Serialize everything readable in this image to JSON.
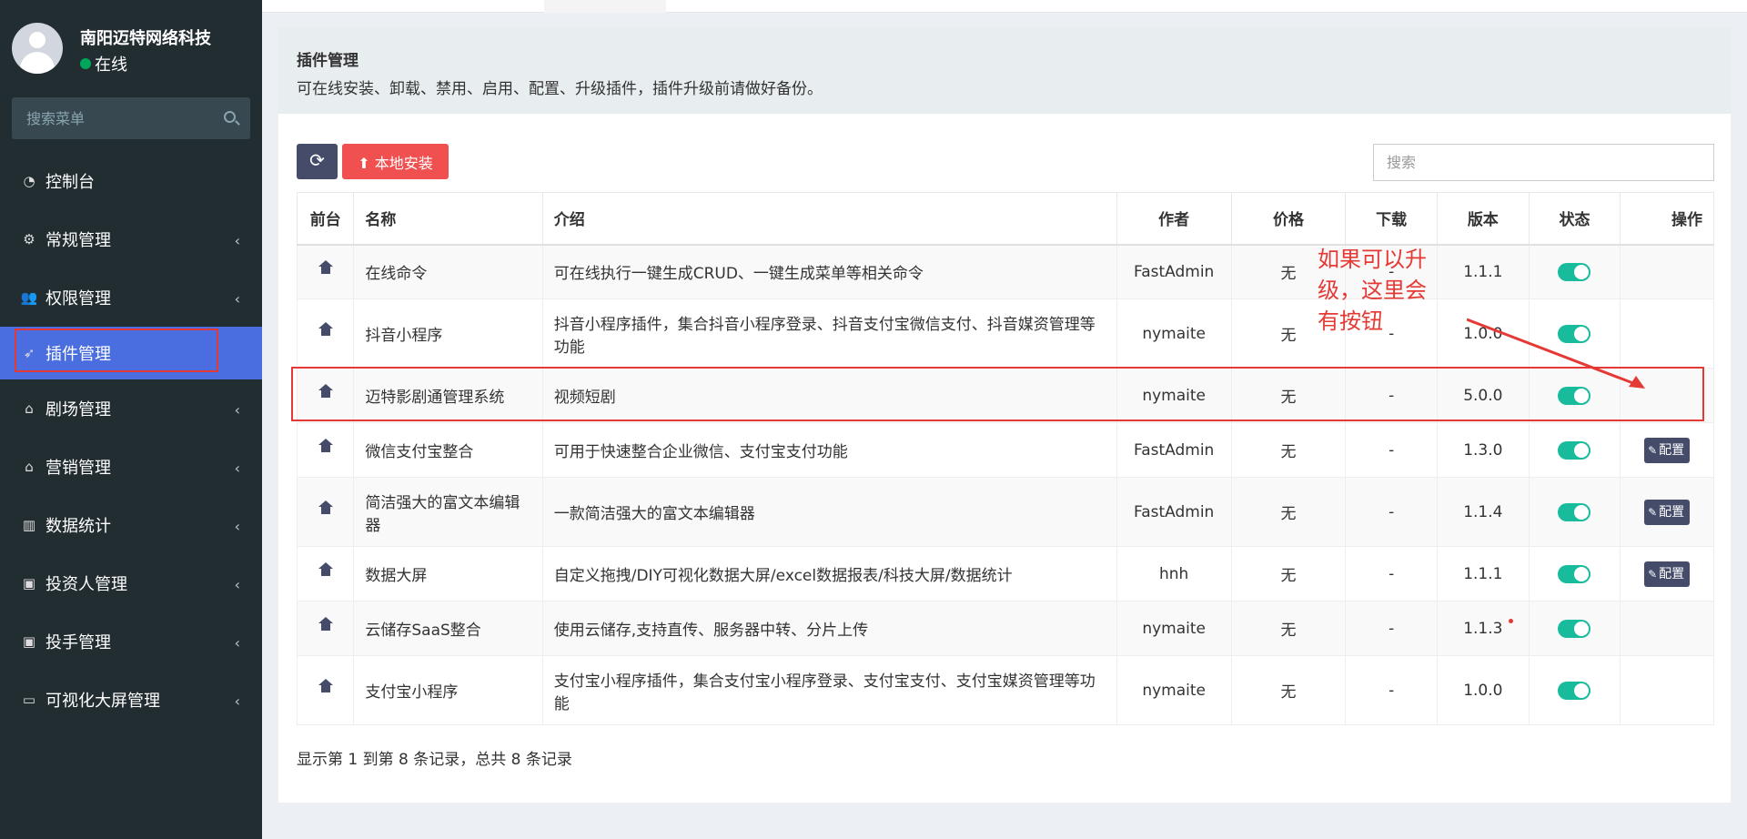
{
  "sidebar": {
    "user_name": "南阳迈特网络科技",
    "user_status": "在线",
    "search_placeholder": "搜索菜单",
    "items": [
      {
        "label": "控制台",
        "icon": "dashboard-icon",
        "has_chevron": false
      },
      {
        "label": "常规管理",
        "icon": "cogs-icon",
        "has_chevron": true
      },
      {
        "label": "权限管理",
        "icon": "users-icon",
        "has_chevron": true
      },
      {
        "label": "插件管理",
        "icon": "rocket-icon",
        "has_chevron": false,
        "active": true
      },
      {
        "label": "剧场管理",
        "icon": "home-icon",
        "has_chevron": true
      },
      {
        "label": "营销管理",
        "icon": "home-icon",
        "has_chevron": true
      },
      {
        "label": "数据统计",
        "icon": "bar-chart-icon",
        "has_chevron": true
      },
      {
        "label": "投资人管理",
        "icon": "id-card-icon",
        "has_chevron": true
      },
      {
        "label": "投手管理",
        "icon": "id-card-icon",
        "has_chevron": true
      },
      {
        "label": "可视化大屏管理",
        "icon": "credit-card-icon",
        "has_chevron": true
      }
    ]
  },
  "panel": {
    "title": "插件管理",
    "description": "可在线安装、卸载、禁用、启用、配置、升级插件，插件升级前请做好备份。"
  },
  "toolbar": {
    "install_label": "本地安装",
    "search_placeholder": "搜索"
  },
  "table": {
    "headers": {
      "front": "前台",
      "name": "名称",
      "intro": "介绍",
      "author": "作者",
      "price": "价格",
      "download": "下载",
      "version": "版本",
      "status": "状态",
      "op": "操作"
    },
    "rows": [
      {
        "name": "在线命令",
        "intro": "可在线执行一键生成CRUD、一键生成菜单等相关命令",
        "author": "FastAdmin",
        "price": "无",
        "download": "-",
        "version": "1.1.1",
        "status": "on",
        "op": ""
      },
      {
        "name": "抖音小程序",
        "intro": "抖音小程序插件，集合抖音小程序登录、抖音支付宝微信支付、抖音媒资管理等功能",
        "author": "nymaite",
        "price": "无",
        "download": "-",
        "version": "1.0.0",
        "status": "on",
        "op": ""
      },
      {
        "name": "迈特影剧通管理系统",
        "intro": "视频短剧",
        "author": "nymaite",
        "price": "无",
        "download": "-",
        "version": "5.0.0",
        "status": "on",
        "op": ""
      },
      {
        "name": "微信支付宝整合",
        "intro": "可用于快速整合企业微信、支付宝支付功能",
        "author": "FastAdmin",
        "price": "无",
        "download": "-",
        "version": "1.3.0",
        "status": "on",
        "op": "配置"
      },
      {
        "name": "简洁强大的富文本编辑器",
        "intro": "一款简洁强大的富文本编辑器",
        "author": "FastAdmin",
        "price": "无",
        "download": "-",
        "version": "1.1.4",
        "status": "on",
        "op": "配置"
      },
      {
        "name": "数据大屏",
        "intro": "自定义拖拽/DIY可视化数据大屏/excel数据报表/科技大屏/数据统计",
        "author": "hnh",
        "price": "无",
        "download": "-",
        "version": "1.1.1",
        "status": "on",
        "op": "配置"
      },
      {
        "name": "云储存SaaS整合",
        "intro": "使用云储存,支持直传、服务器中转、分片上传",
        "author": "nymaite",
        "price": "无",
        "download": "-",
        "version": "1.1.3",
        "status": "on",
        "op": ""
      },
      {
        "name": "支付宝小程序",
        "intro": "支付宝小程序插件，集合支付宝小程序登录、支付宝支付、支付宝媒资管理等功能",
        "author": "nymaite",
        "price": "无",
        "download": "-",
        "version": "1.0.0",
        "status": "on",
        "op": ""
      }
    ]
  },
  "footer": {
    "count_text": "显示第 1 到第 8 条记录，总共 8 条记录"
  },
  "annotation": {
    "text": "如果可以升级，这里会有按钮"
  },
  "colors": {
    "sidebar_bg": "#222d32",
    "active_item": "#4a6ee0",
    "toggle_on": "#18bc9c",
    "danger": "#f05050",
    "dark_button": "#444c69",
    "annotation_red": "#e53935"
  }
}
